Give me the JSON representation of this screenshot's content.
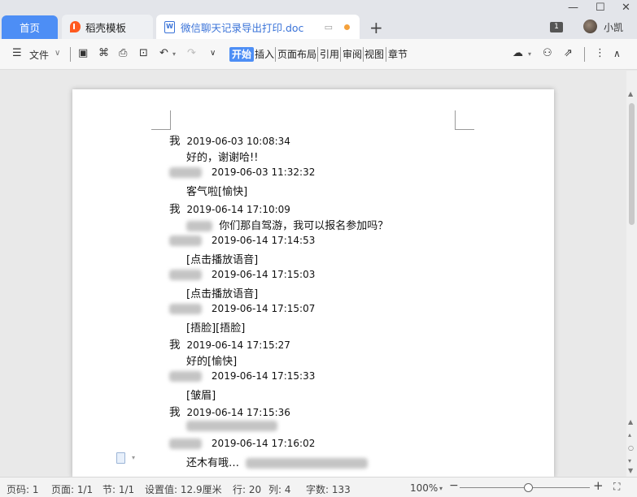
{
  "tabs": [
    {
      "label": "首页"
    },
    {
      "label": "稻壳模板"
    },
    {
      "label": "微信聊天记录导出打印.doc"
    }
  ],
  "window": {
    "badge": "1",
    "user": "小凯"
  },
  "toolbar": {
    "file_label": "文件",
    "menu_tabs": [
      "开始",
      "插入",
      "页面布局",
      "引用",
      "审阅",
      "视图",
      "章节"
    ]
  },
  "chat": [
    {
      "sender": "我",
      "time": "2019-06-03 10:08:34",
      "message": "好的，谢谢哈!!"
    },
    {
      "sender": "",
      "time": "2019-06-03 11:32:32",
      "message": "客气啦[愉快]"
    },
    {
      "sender": "我",
      "time": "2019-06-14 17:10:09",
      "message": "你们那自驾游，我可以报名参加吗？"
    },
    {
      "sender": "",
      "time": "2019-06-14 17:14:53",
      "message": "[点击播放语音]"
    },
    {
      "sender": "",
      "time": "2019-06-14 17:15:03",
      "message": "[点击播放语音]"
    },
    {
      "sender": "",
      "time": "2019-06-14 17:15:07",
      "message": "[捂脸][捂脸]"
    },
    {
      "sender": "我",
      "time": "2019-06-14 17:15:27",
      "message": "好的[愉快]"
    },
    {
      "sender": "",
      "time": "2019-06-14 17:15:33",
      "message": "[皱眉]"
    },
    {
      "sender": "我",
      "time": "2019-06-14 17:15:36",
      "message": ""
    },
    {
      "sender": "",
      "time": "2019-06-14 17:16:02",
      "message": "还木有哦…"
    }
  ],
  "status": {
    "page_num": "页码: 1",
    "pages": "页面: 1/1",
    "section": "节: 1/1",
    "setting": "设置值: 12.9厘米",
    "row": "行: 20",
    "col": "列: 4",
    "words": "字数: 133",
    "zoom": "100%"
  },
  "colors": {
    "accent": "#4d8ef5",
    "doc_tab_text": "#3a73d8",
    "unsaved_dot": "#f5a13b"
  }
}
